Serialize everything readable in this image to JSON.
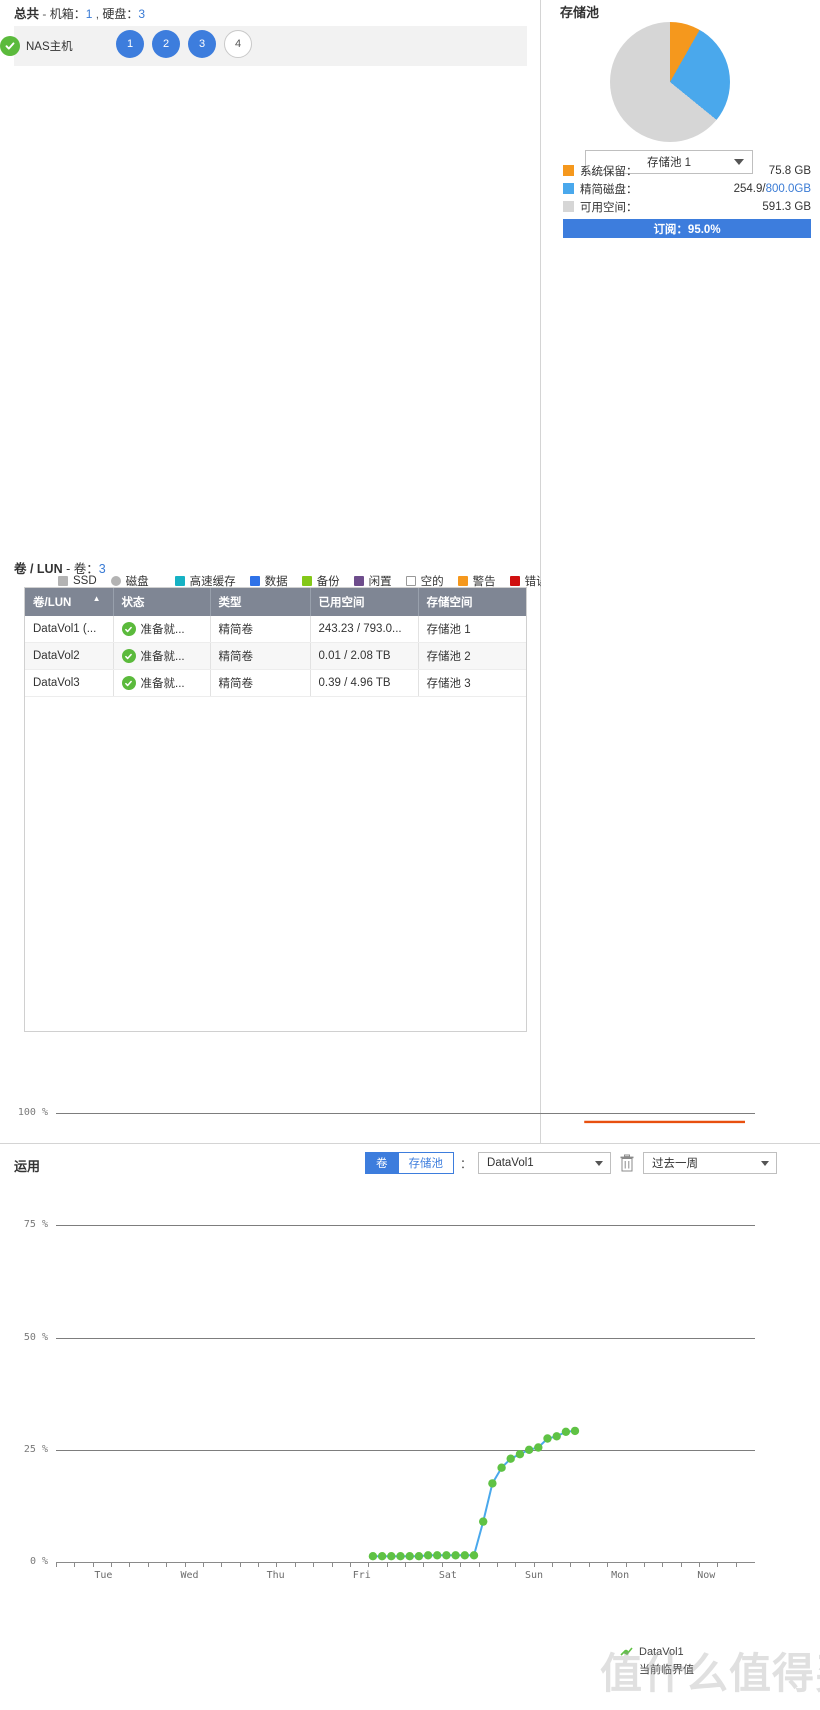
{
  "total": {
    "label": "总共",
    "dash": " - ",
    "enclosure_label": "机箱：",
    "enclosure_count": "1",
    "comma": " , ",
    "disk_label": "硬盘：",
    "disk_count": "3"
  },
  "enclosure": {
    "host_label": "NAS主机",
    "status_icon": "check-circle-icon",
    "bays": [
      {
        "num": "1",
        "state": "filled"
      },
      {
        "num": "2",
        "state": "filled"
      },
      {
        "num": "3",
        "state": "filled"
      },
      {
        "num": "4",
        "state": "empty"
      }
    ],
    "legend": [
      {
        "label": "SSD",
        "color": "#b3b3b3",
        "shape": "square"
      },
      {
        "label": "磁盘",
        "color": "#b3b3b3",
        "shape": "circle"
      },
      {
        "label": "高速缓存",
        "color": "#16b2c4",
        "shape": "square"
      },
      {
        "label": "数据",
        "color": "#2f72e8",
        "shape": "square"
      },
      {
        "label": "备份",
        "color": "#84c818",
        "shape": "square"
      },
      {
        "label": "闲置",
        "color": "#6e4d8c",
        "shape": "square"
      },
      {
        "label": "空的",
        "color": "#ffffff",
        "shape": "hollow"
      },
      {
        "label": "警告",
        "color": "#f5981d",
        "shape": "square"
      },
      {
        "label": "错误",
        "color": "#d01010",
        "shape": "square"
      }
    ]
  },
  "volumes": {
    "title_main": "卷 / LUN",
    "title_dash": " - ",
    "title_sub": "卷：",
    "count": "3",
    "columns": [
      "卷/LUN",
      "状态",
      "类型",
      "已用空间",
      "存储空间"
    ],
    "sort_indicator": "▲",
    "rows": [
      {
        "name": "DataVol1 (...",
        "status": "准备就...",
        "type": "精简卷",
        "used": "243.23 / 793.0...",
        "pool": "存储池 1"
      },
      {
        "name": "DataVol2",
        "status": "准备就...",
        "type": "精简卷",
        "used": "0.01 / 2.08 TB",
        "pool": "存储池 2"
      },
      {
        "name": "DataVol3",
        "status": "准备就...",
        "type": "精简卷",
        "used": "0.39 / 4.96 TB",
        "pool": "存储池 3"
      }
    ]
  },
  "pool": {
    "title": "存储池",
    "selected": "存储池 1",
    "rows": [
      {
        "label": "系统保留：",
        "value": "75.8 GB",
        "color": "#f5981d"
      },
      {
        "label": "精简磁盘：",
        "value": "254.9/",
        "value_hi": "800.0GB",
        "color": "#4aa8ec"
      },
      {
        "label": "可用空间：",
        "value": "591.3 GB",
        "color": "#d6d6d6"
      }
    ],
    "subscription": "订阅：95.0%",
    "chart_data": {
      "type": "pie",
      "title": "存储池",
      "labels": [
        "系统保留",
        "精简磁盘",
        "可用空间"
      ],
      "values": [
        75.8,
        254.9,
        591.3
      ],
      "unit": "GB",
      "colors": [
        "#f5981d",
        "#4aa8ec",
        "#d6d6d6"
      ],
      "legend": "bottom"
    }
  },
  "usage": {
    "title": "运用",
    "tab_volume": "卷",
    "tab_pool": "存储池",
    "colon": "：",
    "selected_volume": "DataVol1",
    "delete_icon": "trash-icon",
    "time_range": "过去一周",
    "chart_data": {
      "type": "line",
      "title": "运用",
      "ylabel": "",
      "xlabel": "",
      "ylim": [
        0,
        100
      ],
      "yticks": [
        "0 %",
        "25 %",
        "50 %",
        "75 %",
        "100 %"
      ],
      "ytick_values": [
        0,
        25,
        50,
        75,
        100
      ],
      "xticks": [
        "Tue",
        "Wed",
        "Thu",
        "Fri",
        "Sat",
        "Sun",
        "Mon",
        "Now"
      ],
      "grid": true,
      "legend": [
        "DataVol1",
        "当前临界值"
      ],
      "series": [
        {
          "name": "DataVol1",
          "color": "#5fc244",
          "line_color": "#4aa8ec",
          "x": [
            34.5,
            35.5,
            36.5,
            37.5,
            38.5,
            39.5,
            40.5,
            41.5,
            42.5,
            43.5,
            44.5,
            45.5,
            46.5,
            47.5,
            48.5,
            49.5,
            50.5,
            51.5,
            52.5,
            53.5,
            54.5,
            55.5,
            56.5
          ],
          "values": [
            1.3,
            1.3,
            1.3,
            1.3,
            1.3,
            1.3,
            1.5,
            1.5,
            1.5,
            1.5,
            1.5,
            1.5,
            9.0,
            17.5,
            21.0,
            23.0,
            24.0,
            25.0,
            25.5,
            27.5,
            28.0,
            29.0,
            29.2
          ]
        },
        {
          "name": "当前临界值",
          "color": "#e8500f",
          "type": "threshold",
          "value": 98.0,
          "x_start": 57.5,
          "x_end": 75.0
        }
      ]
    }
  },
  "watermark": "值什么值得买"
}
